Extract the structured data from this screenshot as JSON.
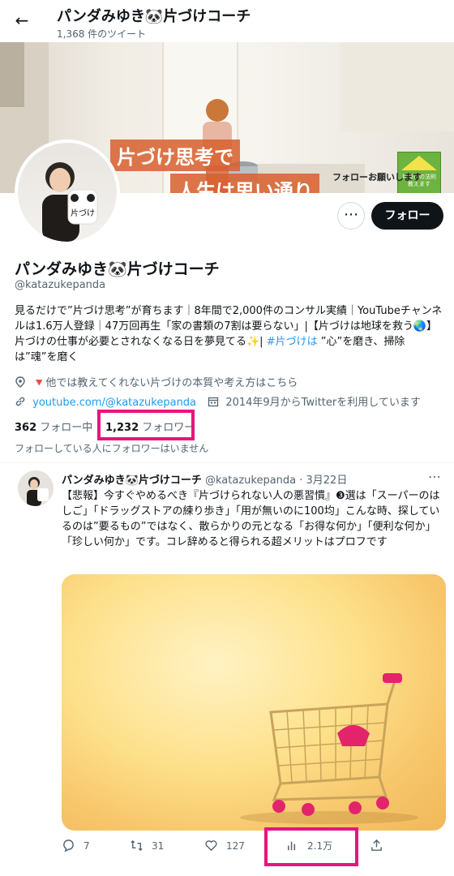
{
  "header": {
    "back_icon": "arrow-left-icon",
    "title": "パンダみゆき🐼片づけコーチ",
    "tweet_count": "1,368 件のツイート"
  },
  "banner": {
    "headline_1": "片づけ思考で",
    "headline_2": "人生は思い通り",
    "follow_request": "フォローお願いします",
    "logo_text": "片づけの法則教えます"
  },
  "profile": {
    "more_label": "⋯",
    "follow_label": "フォロー",
    "name": "パンダみゆき🐼片づけコーチ",
    "handle": "@katazukepanda",
    "bio_1": "見るだけで”片づけ思考”が育ちます｜8年間で2,000件のコンサル実績｜YouTubeチャンネルは1.6万人登録｜47万回再生「家の書類の7割は要らない」|【片づけは地球を救う🌏】片づけの仕事が必要とされなくなる日を夢見てる✨|",
    "bio_hashtag": "#片づけは",
    "bio_2": "”心”を磨き、掃除は”魂”を磨く",
    "location": "🔻他では教えてくれない片づけの本質や考え方はこちら",
    "url": "youtube.com/@katazukepanda",
    "joined": "2014年9月からTwitterを利用しています",
    "following_count": "362",
    "following_label": "フォロー中",
    "followers_count": "1,232",
    "followers_label": "フォロワー",
    "no_mutual": "フォローしている人にフォロワーはいません"
  },
  "tweet": {
    "author": "パンダみゆき🐼片づけコーチ",
    "handle_date": "@katazukepanda · 3月22日",
    "more_label": "⋯",
    "text": "【悲報】今すぐやめるべき『片づけられない人の悪習慣』❸選は「スーパーのはしご」「ドラッグストアの練り歩き」「用が無いのに100均」こんな時、探しているのは”要るもの”ではなく、散らかりの元となる「お得な何か」「便利な何か」「珍しい何か」です。コレ辞めると得られる超メリットはプロフです",
    "replies": "7",
    "retweets": "31",
    "likes": "127",
    "views": "2.1万"
  },
  "colors": {
    "highlight": "#e8147d",
    "link": "#1d9bf0",
    "text_secondary": "#536471"
  }
}
